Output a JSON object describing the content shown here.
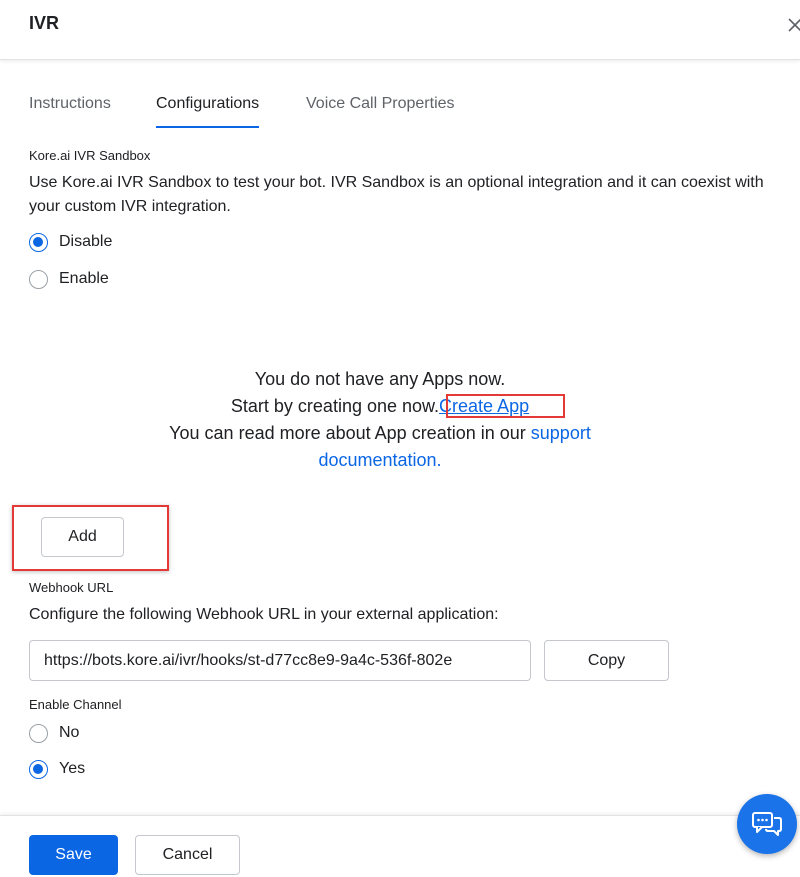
{
  "dialog": {
    "title": "IVR"
  },
  "tabs": [
    {
      "label": "Instructions",
      "active": false
    },
    {
      "label": "Configurations",
      "active": true
    },
    {
      "label": "Voice Call Properties",
      "active": false
    }
  ],
  "sandbox": {
    "label": "Kore.ai IVR Sandbox",
    "description": "Use Kore.ai IVR Sandbox to test your bot. IVR Sandbox is an optional integration and it can coexist with your custom IVR integration.",
    "options": [
      {
        "label": "Disable",
        "checked": true
      },
      {
        "label": "Enable",
        "checked": false
      }
    ]
  },
  "apps": {
    "empty_line1": "You do not have any Apps now.",
    "empty_line2_prefix": "Start by creating one now.",
    "create_app_link": "Create App",
    "empty_line3_prefix": "You can read more about App creation in our",
    "support_link_1": "support",
    "support_link_2": "documentation.",
    "add_button": "Add"
  },
  "webhook": {
    "label": "Webhook URL",
    "description": "Configure the following Webhook URL in your external application:",
    "url": "https://bots.kore.ai/ivr/hooks/st-d77cc8e9-9a4c-536f-802e",
    "copy_button": "Copy"
  },
  "enable_channel": {
    "label": "Enable Channel",
    "options": [
      {
        "label": "No",
        "checked": false
      },
      {
        "label": "Yes",
        "checked": true
      }
    ]
  },
  "footer": {
    "save": "Save",
    "cancel": "Cancel"
  },
  "icons": {
    "close": "close-icon",
    "chat": "chat-bubbles-icon"
  },
  "colors": {
    "accent": "#0b66e4",
    "highlight": "#e53935",
    "fab": "#1a73e8"
  }
}
